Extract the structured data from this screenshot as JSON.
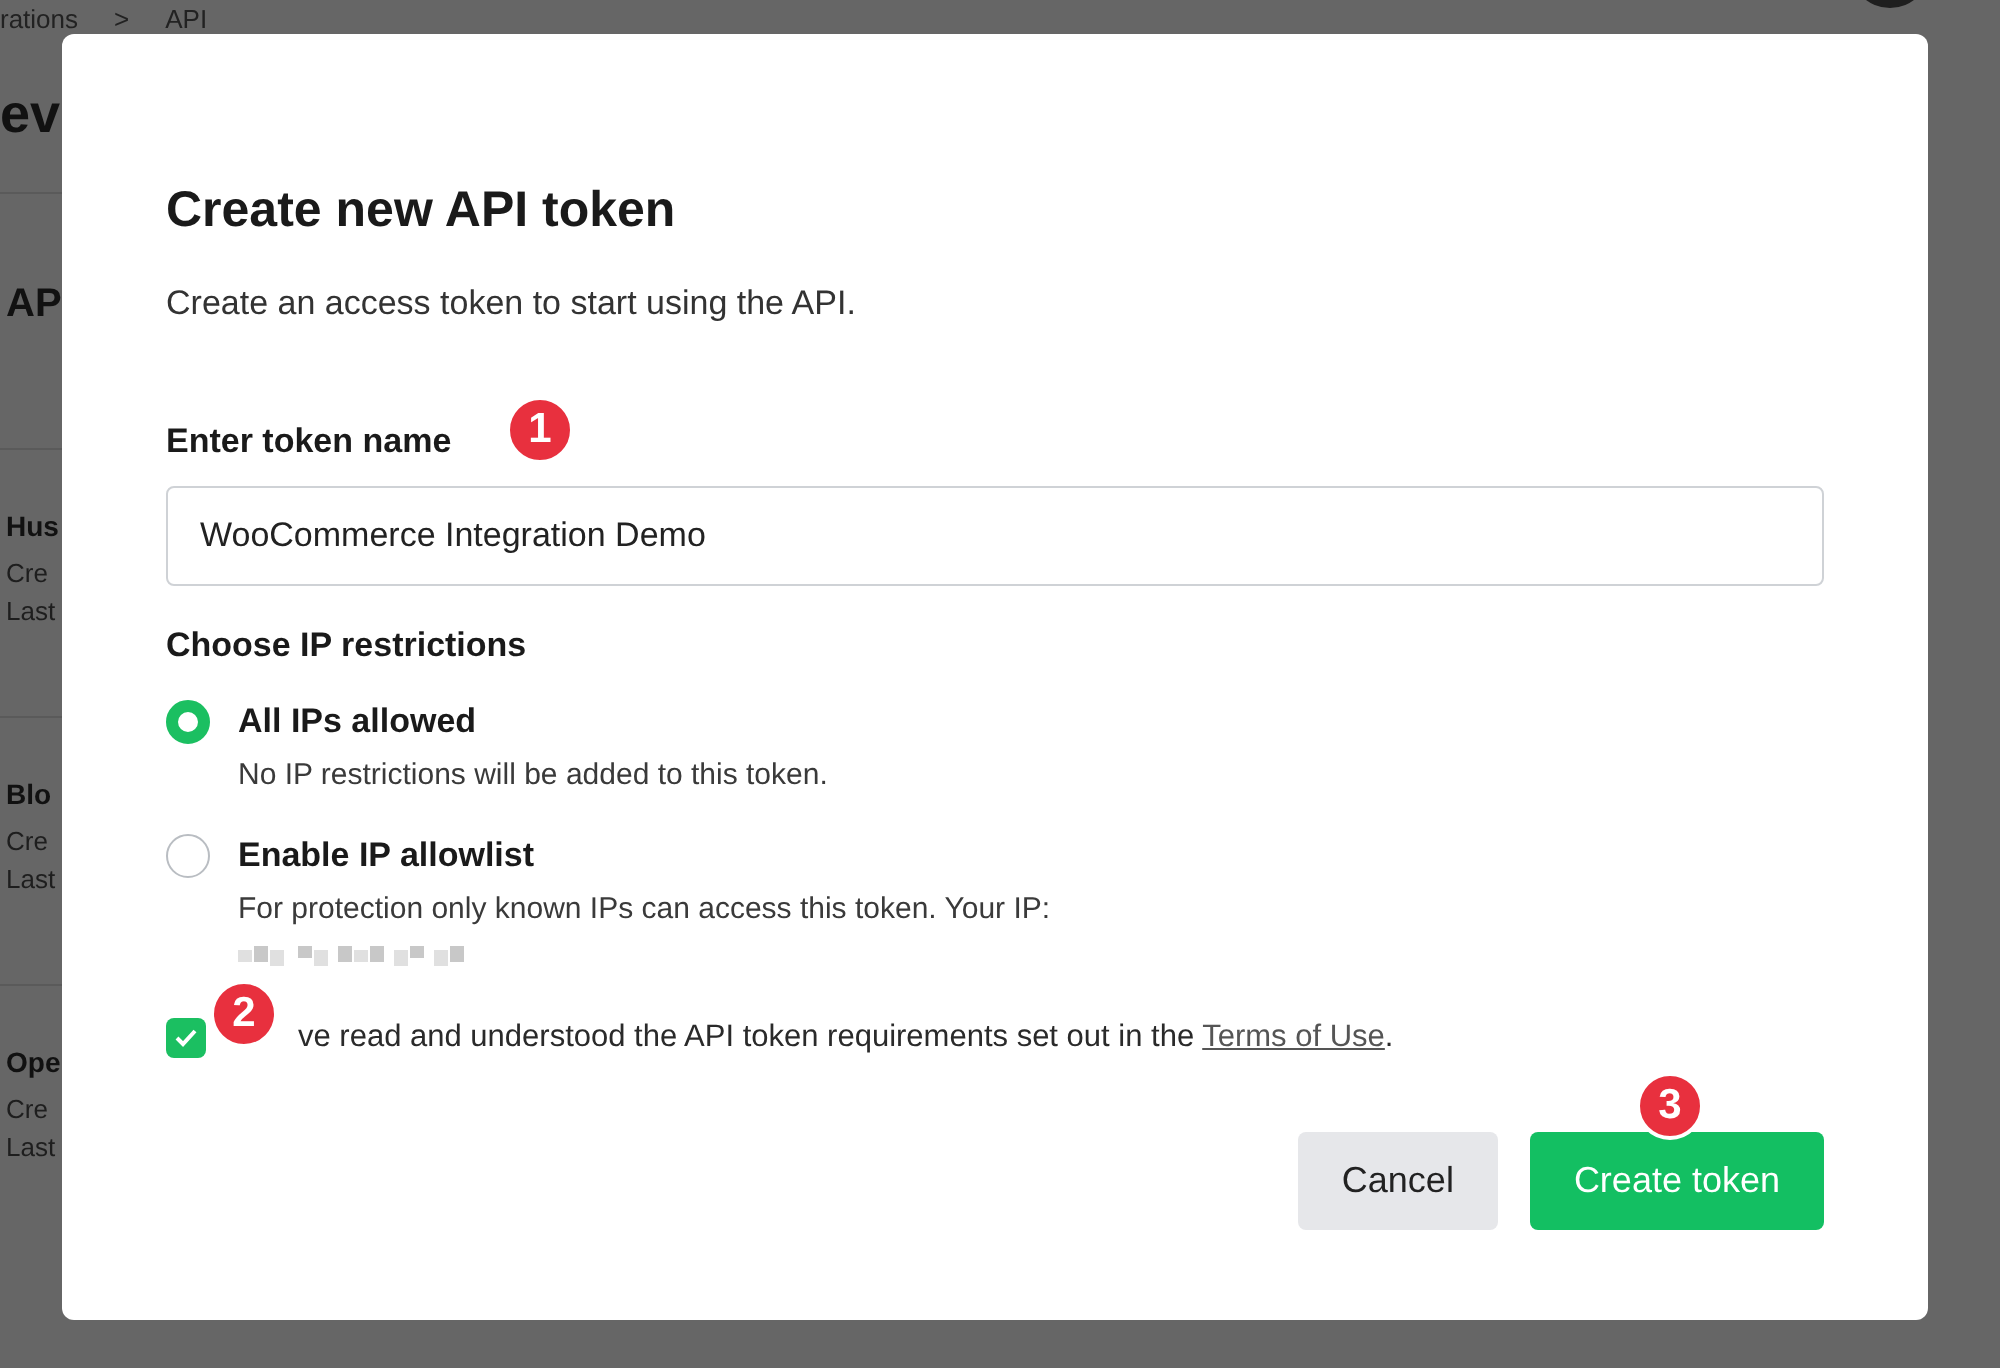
{
  "background_page": {
    "breadcrumb": [
      "rations",
      ">",
      "API"
    ],
    "title": "ev",
    "section_title": "AP",
    "tokens": [
      {
        "name": "Hus",
        "created": "Cre",
        "last_used": "Last"
      },
      {
        "name": "Blo",
        "created": "Cre",
        "last_used": "Last"
      },
      {
        "name": "Ope",
        "created": "Cre",
        "last_used": "Last"
      }
    ]
  },
  "dialog": {
    "title": "Create new API token",
    "subtitle": "Create an access token to start using the API.",
    "name_field": {
      "label": "Enter token name",
      "value": "WooCommerce Integration Demo"
    },
    "ip_restrictions": {
      "label": "Choose IP restrictions",
      "options": [
        {
          "label": "All IPs allowed",
          "description": "No IP restrictions will be added to this token.",
          "selected": true,
          "redacted_ip": false
        },
        {
          "label": "Enable IP allowlist",
          "description": "For protection only known IPs can access this token. Your IP:",
          "selected": false,
          "redacted_ip": true
        }
      ]
    },
    "terms": {
      "checked": true,
      "text": "ve read and understood the API token requirements set out in the ",
      "link": "Terms of Use",
      "end": "."
    },
    "buttons": [
      {
        "label": "Cancel",
        "kind": "secondary"
      },
      {
        "label": "Create token",
        "kind": "primary"
      }
    ]
  },
  "step_badges": [
    {
      "label": "1"
    },
    {
      "label": "2"
    },
    {
      "label": "3"
    }
  ]
}
